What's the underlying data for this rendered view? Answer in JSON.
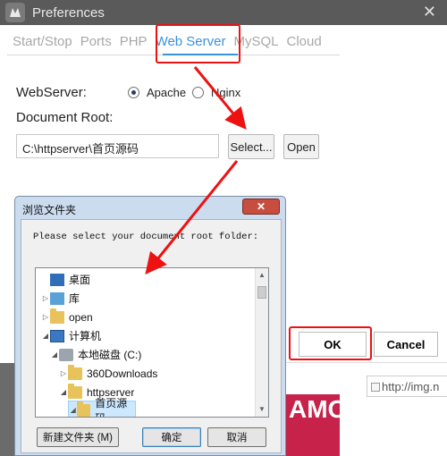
{
  "window": {
    "title": "Preferences",
    "close_glyph": "✕"
  },
  "tabs": [
    {
      "label": "Start/Stop"
    },
    {
      "label": "Ports"
    },
    {
      "label": "PHP"
    },
    {
      "label": "Web Server",
      "active": true
    },
    {
      "label": "MySQL"
    },
    {
      "label": "Cloud"
    }
  ],
  "webserver": {
    "label": "WebServer:",
    "options": [
      {
        "label": "Apache",
        "selected": true
      },
      {
        "label": "Nginx",
        "selected": false
      }
    ]
  },
  "docroot": {
    "label": "Document Root:",
    "value": "C:\\httpserver\\首页源码",
    "select_label": "Select...",
    "open_label": "Open"
  },
  "footer": {
    "ok_label": "OK",
    "cancel_label": "Cancel"
  },
  "background": {
    "image_alt": "http://img.n",
    "banner_text": "AMOUT"
  },
  "dialog": {
    "title": "浏览文件夹",
    "close_glyph": "✕",
    "prompt": "Please select your document root folder:",
    "tree": [
      {
        "label": "桌面",
        "icon": "desktop-icon",
        "indent": 0,
        "toggle": ""
      },
      {
        "label": "库",
        "icon": "library-icon",
        "indent": 0,
        "toggle": "▷"
      },
      {
        "label": "open",
        "icon": "user-folder-icon",
        "indent": 0,
        "toggle": "▷"
      },
      {
        "label": "计算机",
        "icon": "computer-icon",
        "indent": 0,
        "toggle": "◢"
      },
      {
        "label": "本地磁盘 (C:)",
        "icon": "drive-icon",
        "indent": 1,
        "toggle": "◢"
      },
      {
        "label": "360Downloads",
        "icon": "folder-icon",
        "indent": 2,
        "toggle": "▷"
      },
      {
        "label": "httpserver",
        "icon": "folder-icon",
        "indent": 2,
        "toggle": "◢"
      },
      {
        "label": "首页源码",
        "icon": "folder-icon",
        "indent": 3,
        "toggle": "◢",
        "selected": true
      }
    ],
    "new_folder_label": "新建文件夹 (M)",
    "confirm_label": "确定",
    "cancel_label": "取消"
  },
  "colors": {
    "accent": "#3a92d8",
    "highlight": "#e11111",
    "dialog_frame": "#cbdcef"
  }
}
